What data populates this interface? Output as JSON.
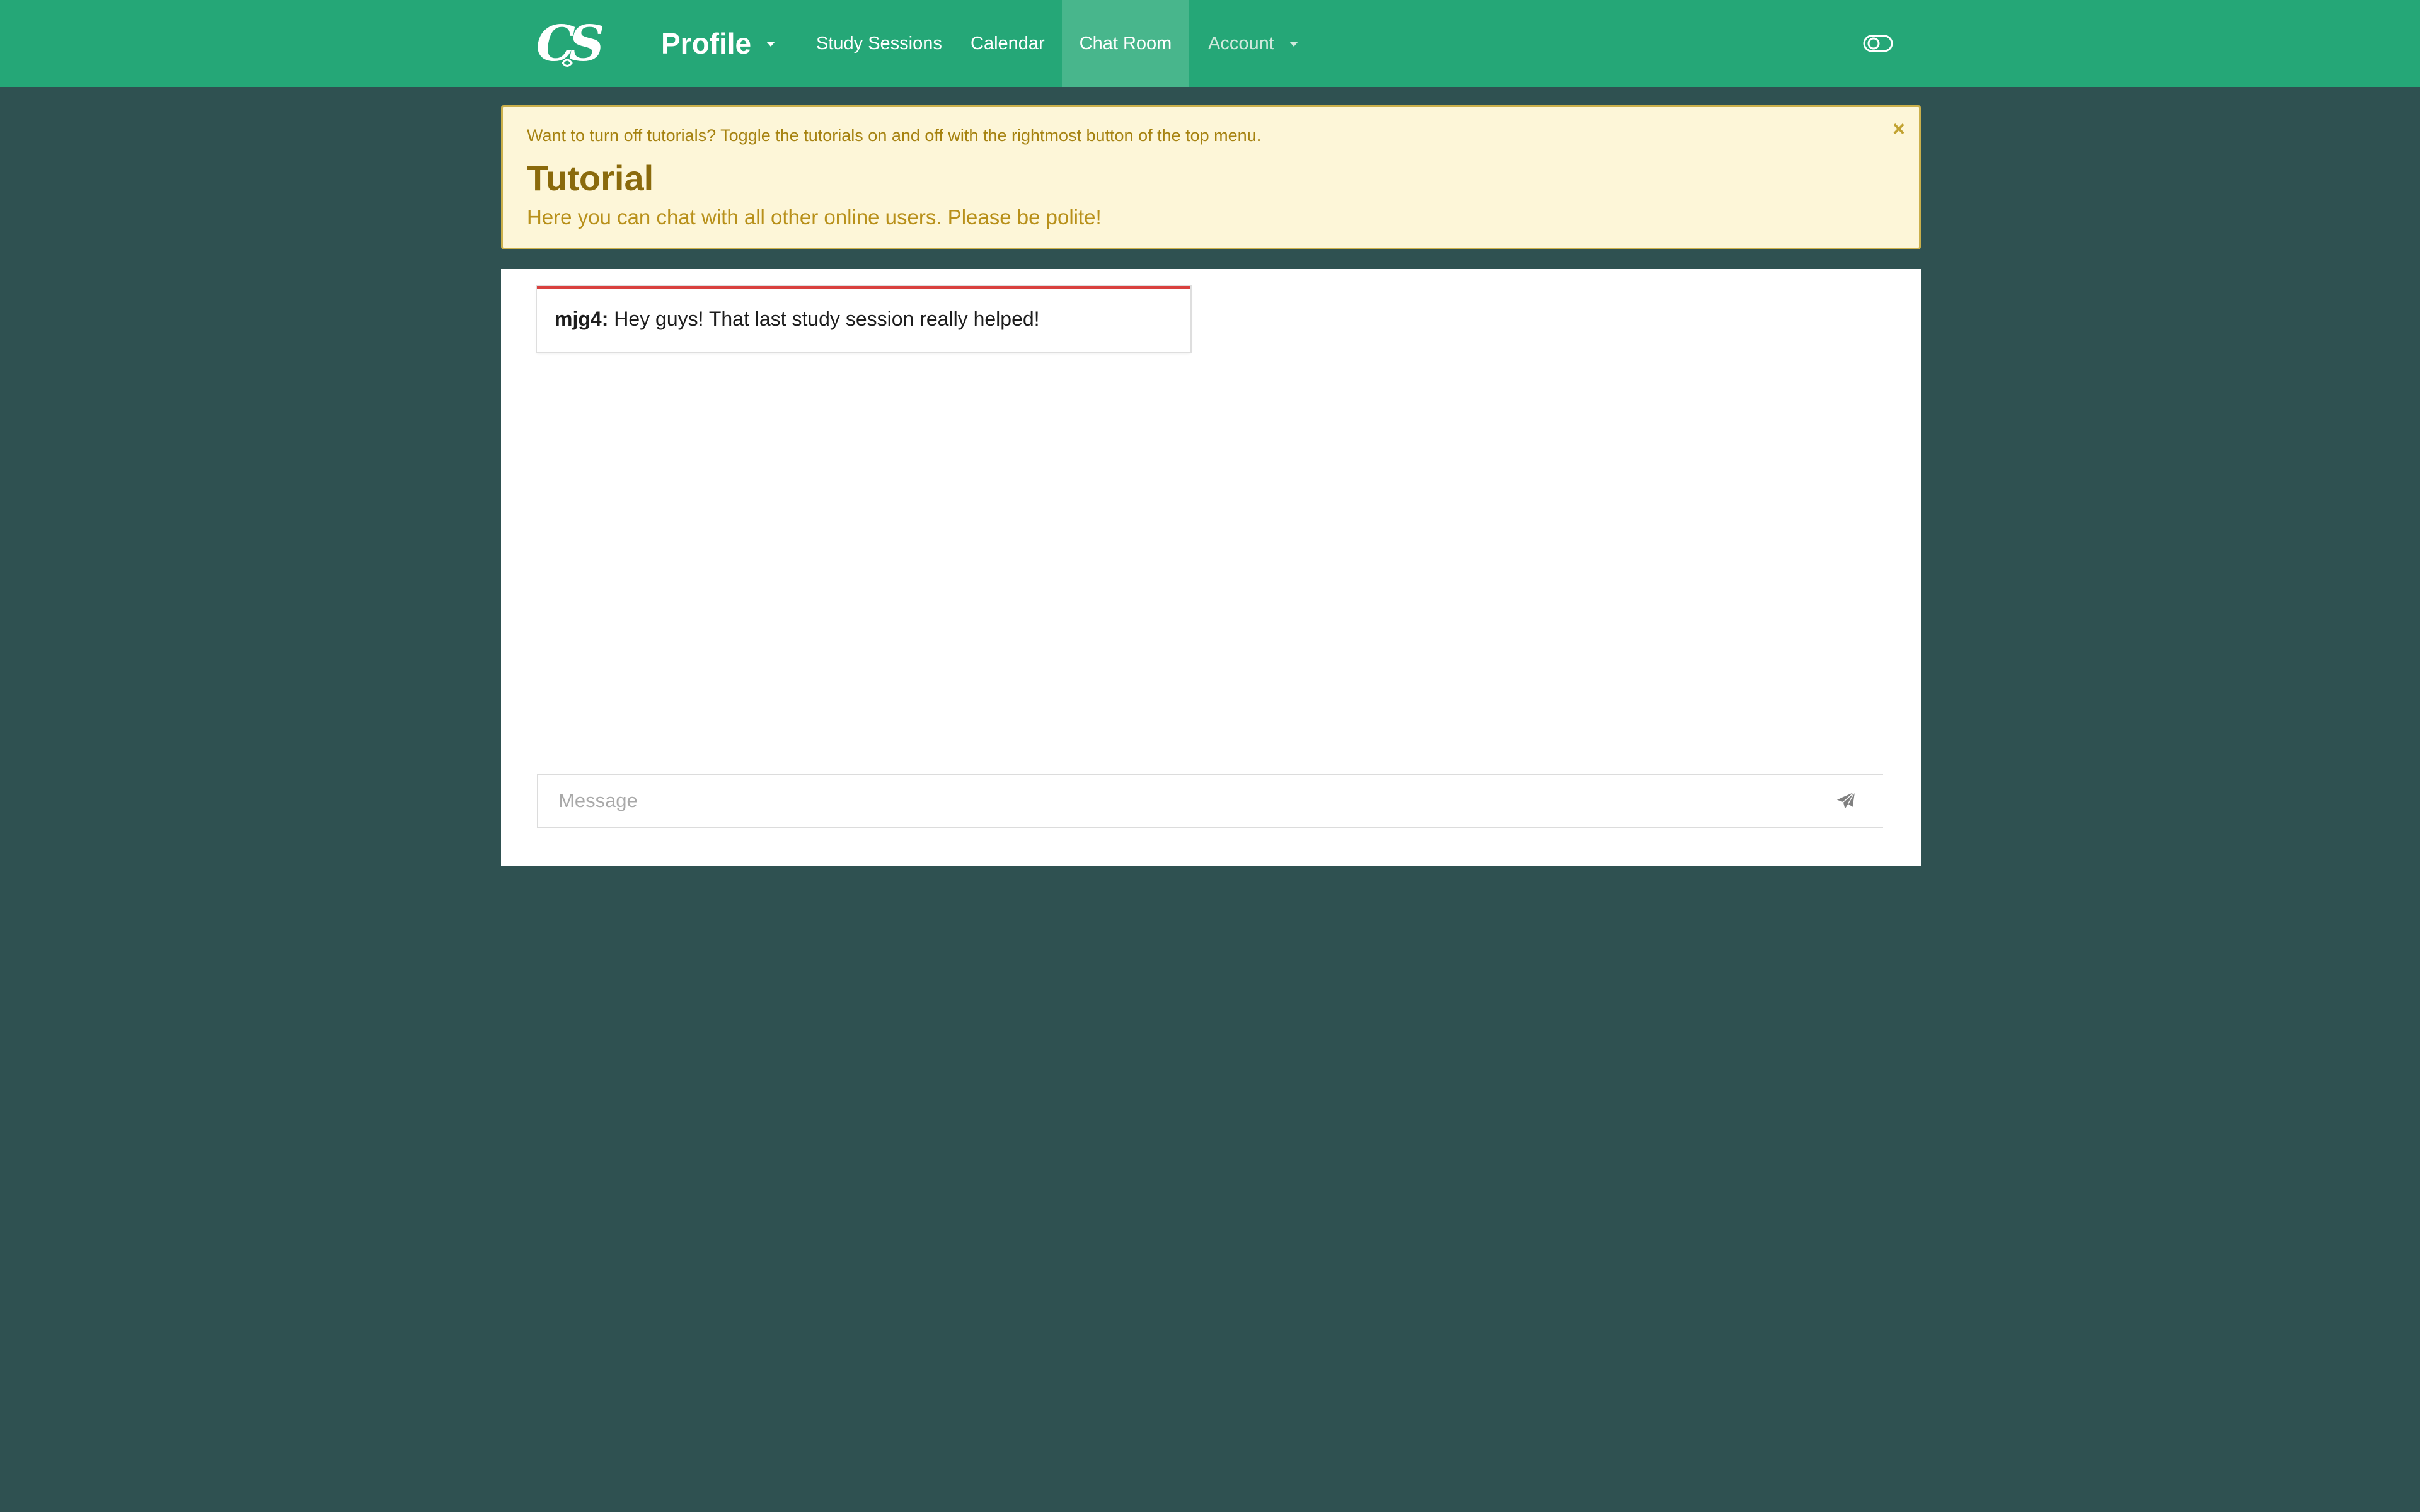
{
  "colors": {
    "navbar": "#25a777",
    "navbar_active": "#48b68c",
    "page_background": "#2f5151",
    "alert_background": "#fdf6d8",
    "alert_border": "#cbb04b",
    "message_accent": "#d9403e"
  },
  "navbar": {
    "logo_text": "CS",
    "items": [
      {
        "label": "Profile",
        "icon": "chevron-down-icon"
      },
      {
        "label": "Study Sessions"
      },
      {
        "label": "Calendar"
      },
      {
        "label": "Chat Room",
        "active": true
      },
      {
        "label": "Account",
        "icon": "chevron-down-icon"
      }
    ],
    "tutorial_toggle_icon": "toggle-icon"
  },
  "alert": {
    "hint": "Want to turn off tutorials? Toggle the tutorials on and off with the rightmost button of the top menu.",
    "title": "Tutorial",
    "body": "Here you can chat with all other online users. Please be polite!",
    "close_label": "×"
  },
  "chat": {
    "messages": [
      {
        "user": "mjg4:",
        "text": " Hey guys! That last study session really helped!"
      }
    ],
    "input": {
      "placeholder": "Message",
      "value": ""
    },
    "send_icon": "paper-plane-icon"
  }
}
